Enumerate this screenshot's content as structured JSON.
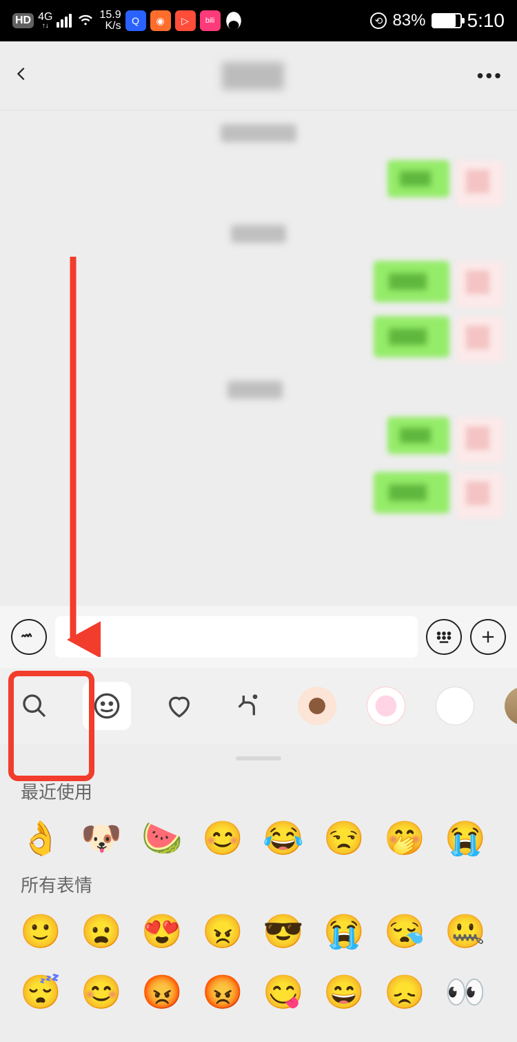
{
  "status": {
    "hd": "HD",
    "net": "4G",
    "speed1": "15.9",
    "speed2": "K/s",
    "battery": "83%",
    "time": "5:10",
    "app_icons": [
      "Q",
      "●",
      "▷",
      "bili",
      "Q"
    ]
  },
  "nav": {
    "title_censored": true
  },
  "input": {
    "placeholder": ""
  },
  "emoji_tabs": {
    "search_icon": "search",
    "tabs": [
      "smiley",
      "heart",
      "peace",
      "girl-sticker",
      "bear-sticker",
      "duck-sticker",
      "cat-sticker"
    ]
  },
  "panel": {
    "section_recent": "最近使用",
    "section_all": "所有表情",
    "recent": [
      "👌",
      "🐶",
      "🍉",
      "😊",
      "😂",
      "😒",
      "🤭",
      "😭"
    ],
    "all_row1": [
      "🙂",
      "😦",
      "😍",
      "😠",
      "😎",
      "😭",
      "😪",
      "🤐"
    ],
    "all_row2": [
      "😴",
      "😊",
      "😡",
      "😡",
      "😋",
      "😄",
      "😞",
      "👀"
    ]
  },
  "annotations": {
    "arrow_color": "#f23c2c",
    "box_color": "#f23c2c"
  }
}
